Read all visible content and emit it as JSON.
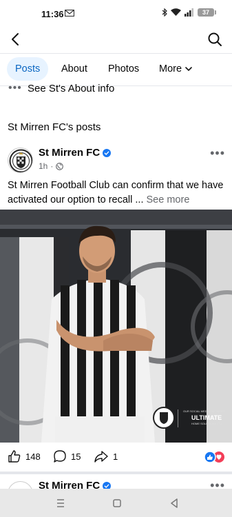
{
  "status_bar": {
    "time": "11:36",
    "battery": "37"
  },
  "tabs": [
    {
      "label": "Posts"
    },
    {
      "label": "About"
    },
    {
      "label": "Photos"
    },
    {
      "label": "More"
    }
  ],
  "about_link": {
    "text": "See St's About info"
  },
  "section": {
    "title": "St Mirren FC's posts"
  },
  "post": {
    "author": "St Mirren FC",
    "time": "1h",
    "text": "St Mirren Football Club can confirm that we have activated our option to recall ...",
    "see_more": "See more",
    "image_sponsor_small": "OUR SOCIAL MEDIA PARTNERS",
    "image_sponsor_name": "ULTIMATE",
    "image_sponsor_sub": "HOME SOLUTIONS LTD",
    "likes": "148",
    "comments": "15",
    "shares": "1"
  },
  "post2": {
    "author": "St Mirren FC"
  },
  "colors": {
    "accent": "#0a66c2",
    "tab_active_bg": "#e7f3ff",
    "verified": "#1877f2",
    "love": "#f33e58"
  }
}
